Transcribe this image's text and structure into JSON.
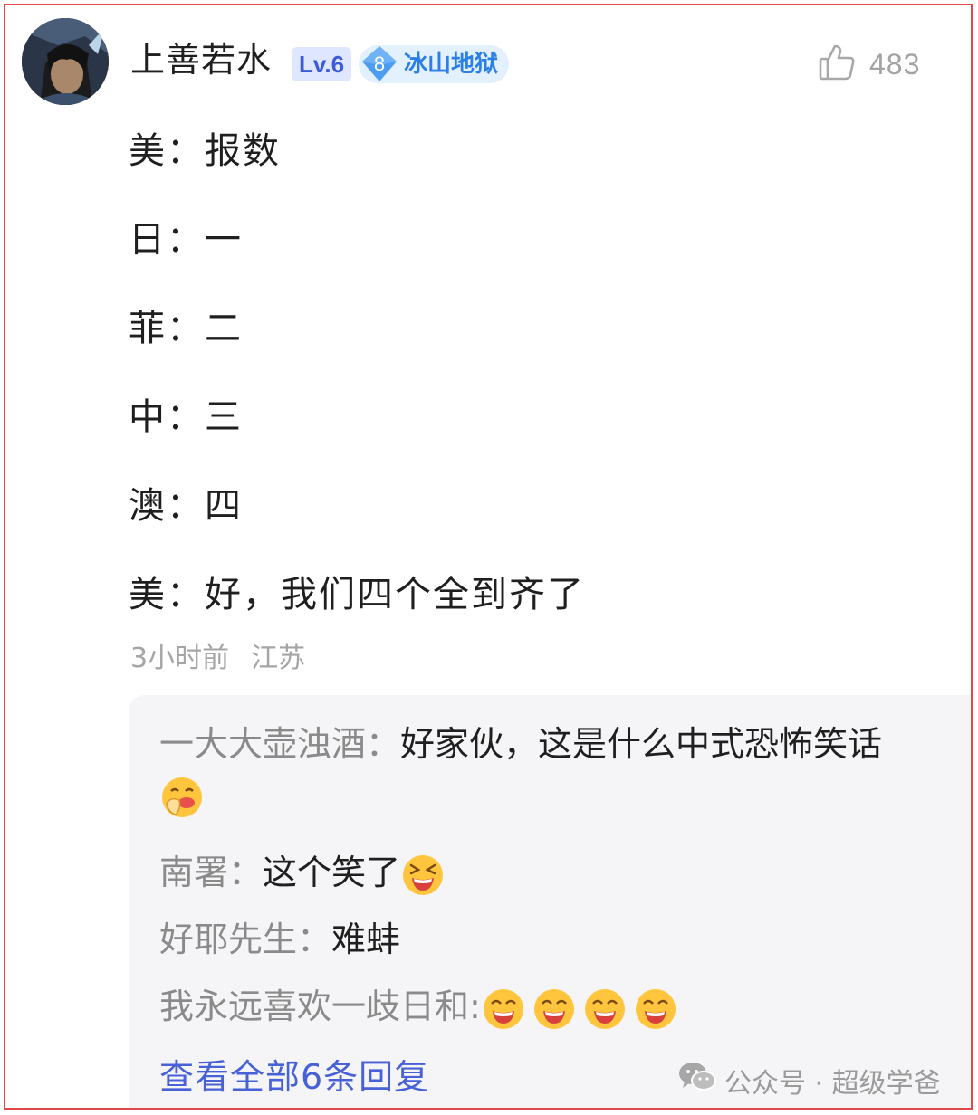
{
  "comment": {
    "username": "上善若水",
    "level_badge": "Lv.6",
    "fan_badge": {
      "level": "8",
      "name": "冰山地狱"
    },
    "likes": "483",
    "lines": [
      "美：报数",
      "日：一",
      "菲：二",
      "中：三",
      "澳：四",
      "美：好，我们四个全到齐了"
    ],
    "time": "3小时前",
    "location": "江苏"
  },
  "replies": [
    {
      "author": "一大大壶浊酒：",
      "text": "好家伙，这是什么中式恐怖笑话"
    },
    {
      "author": "南署：",
      "text": "这个笑了"
    },
    {
      "author": "好耶先生：",
      "text": "难蚌"
    },
    {
      "author": "我永远喜欢一歧日和:",
      "text": ""
    }
  ],
  "view_all_label": "查看全部6条回复",
  "watermark": "公众号 · 超级学爸"
}
